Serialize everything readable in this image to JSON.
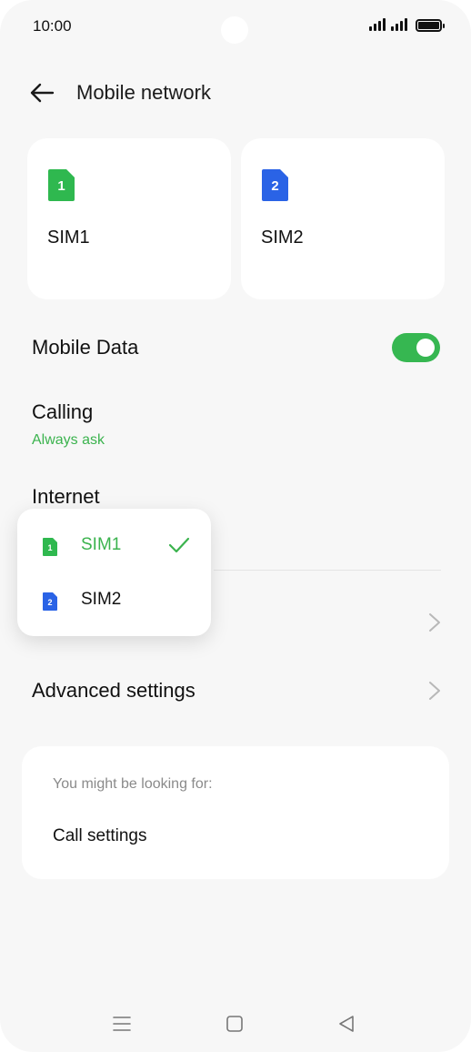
{
  "status_bar": {
    "time": "10:00"
  },
  "header": {
    "title": "Mobile network"
  },
  "sim_cards": [
    {
      "badge": "1",
      "label": "SIM1",
      "color": "#2fb84f"
    },
    {
      "badge": "2",
      "label": "SIM2",
      "color": "#2a63e6"
    }
  ],
  "settings": {
    "mobile_data": {
      "label": "Mobile Data",
      "enabled": true
    },
    "calling": {
      "label": "Calling",
      "value": "Always ask"
    },
    "internet": {
      "label": "Internet"
    },
    "advanced": {
      "label": "Advanced settings"
    }
  },
  "internet_popup": {
    "options": [
      {
        "badge": "1",
        "label": "SIM1",
        "selected": true,
        "color": "#2fb84f"
      },
      {
        "badge": "2",
        "label": "SIM2",
        "selected": false,
        "color": "#2a63e6"
      }
    ]
  },
  "suggestions": {
    "hint": "You might be looking for:",
    "items": [
      {
        "label": "Call settings"
      }
    ]
  },
  "colors": {
    "accent": "#36b751",
    "sim2": "#2a63e6",
    "background": "#f7f7f7"
  }
}
